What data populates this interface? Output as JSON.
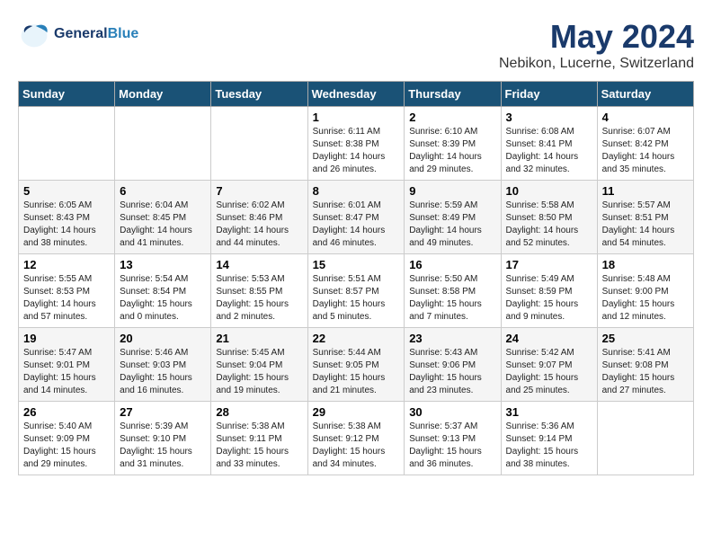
{
  "header": {
    "logo_general": "General",
    "logo_blue": "Blue",
    "month_year": "May 2024",
    "location": "Nebikon, Lucerne, Switzerland"
  },
  "days_of_week": [
    "Sunday",
    "Monday",
    "Tuesday",
    "Wednesday",
    "Thursday",
    "Friday",
    "Saturday"
  ],
  "weeks": [
    [
      {
        "day": "",
        "info": ""
      },
      {
        "day": "",
        "info": ""
      },
      {
        "day": "",
        "info": ""
      },
      {
        "day": "1",
        "info": "Sunrise: 6:11 AM\nSunset: 8:38 PM\nDaylight: 14 hours\nand 26 minutes."
      },
      {
        "day": "2",
        "info": "Sunrise: 6:10 AM\nSunset: 8:39 PM\nDaylight: 14 hours\nand 29 minutes."
      },
      {
        "day": "3",
        "info": "Sunrise: 6:08 AM\nSunset: 8:41 PM\nDaylight: 14 hours\nand 32 minutes."
      },
      {
        "day": "4",
        "info": "Sunrise: 6:07 AM\nSunset: 8:42 PM\nDaylight: 14 hours\nand 35 minutes."
      }
    ],
    [
      {
        "day": "5",
        "info": "Sunrise: 6:05 AM\nSunset: 8:43 PM\nDaylight: 14 hours\nand 38 minutes."
      },
      {
        "day": "6",
        "info": "Sunrise: 6:04 AM\nSunset: 8:45 PM\nDaylight: 14 hours\nand 41 minutes."
      },
      {
        "day": "7",
        "info": "Sunrise: 6:02 AM\nSunset: 8:46 PM\nDaylight: 14 hours\nand 44 minutes."
      },
      {
        "day": "8",
        "info": "Sunrise: 6:01 AM\nSunset: 8:47 PM\nDaylight: 14 hours\nand 46 minutes."
      },
      {
        "day": "9",
        "info": "Sunrise: 5:59 AM\nSunset: 8:49 PM\nDaylight: 14 hours\nand 49 minutes."
      },
      {
        "day": "10",
        "info": "Sunrise: 5:58 AM\nSunset: 8:50 PM\nDaylight: 14 hours\nand 52 minutes."
      },
      {
        "day": "11",
        "info": "Sunrise: 5:57 AM\nSunset: 8:51 PM\nDaylight: 14 hours\nand 54 minutes."
      }
    ],
    [
      {
        "day": "12",
        "info": "Sunrise: 5:55 AM\nSunset: 8:53 PM\nDaylight: 14 hours\nand 57 minutes."
      },
      {
        "day": "13",
        "info": "Sunrise: 5:54 AM\nSunset: 8:54 PM\nDaylight: 15 hours\nand 0 minutes."
      },
      {
        "day": "14",
        "info": "Sunrise: 5:53 AM\nSunset: 8:55 PM\nDaylight: 15 hours\nand 2 minutes."
      },
      {
        "day": "15",
        "info": "Sunrise: 5:51 AM\nSunset: 8:57 PM\nDaylight: 15 hours\nand 5 minutes."
      },
      {
        "day": "16",
        "info": "Sunrise: 5:50 AM\nSunset: 8:58 PM\nDaylight: 15 hours\nand 7 minutes."
      },
      {
        "day": "17",
        "info": "Sunrise: 5:49 AM\nSunset: 8:59 PM\nDaylight: 15 hours\nand 9 minutes."
      },
      {
        "day": "18",
        "info": "Sunrise: 5:48 AM\nSunset: 9:00 PM\nDaylight: 15 hours\nand 12 minutes."
      }
    ],
    [
      {
        "day": "19",
        "info": "Sunrise: 5:47 AM\nSunset: 9:01 PM\nDaylight: 15 hours\nand 14 minutes."
      },
      {
        "day": "20",
        "info": "Sunrise: 5:46 AM\nSunset: 9:03 PM\nDaylight: 15 hours\nand 16 minutes."
      },
      {
        "day": "21",
        "info": "Sunrise: 5:45 AM\nSunset: 9:04 PM\nDaylight: 15 hours\nand 19 minutes."
      },
      {
        "day": "22",
        "info": "Sunrise: 5:44 AM\nSunset: 9:05 PM\nDaylight: 15 hours\nand 21 minutes."
      },
      {
        "day": "23",
        "info": "Sunrise: 5:43 AM\nSunset: 9:06 PM\nDaylight: 15 hours\nand 23 minutes."
      },
      {
        "day": "24",
        "info": "Sunrise: 5:42 AM\nSunset: 9:07 PM\nDaylight: 15 hours\nand 25 minutes."
      },
      {
        "day": "25",
        "info": "Sunrise: 5:41 AM\nSunset: 9:08 PM\nDaylight: 15 hours\nand 27 minutes."
      }
    ],
    [
      {
        "day": "26",
        "info": "Sunrise: 5:40 AM\nSunset: 9:09 PM\nDaylight: 15 hours\nand 29 minutes."
      },
      {
        "day": "27",
        "info": "Sunrise: 5:39 AM\nSunset: 9:10 PM\nDaylight: 15 hours\nand 31 minutes."
      },
      {
        "day": "28",
        "info": "Sunrise: 5:38 AM\nSunset: 9:11 PM\nDaylight: 15 hours\nand 33 minutes."
      },
      {
        "day": "29",
        "info": "Sunrise: 5:38 AM\nSunset: 9:12 PM\nDaylight: 15 hours\nand 34 minutes."
      },
      {
        "day": "30",
        "info": "Sunrise: 5:37 AM\nSunset: 9:13 PM\nDaylight: 15 hours\nand 36 minutes."
      },
      {
        "day": "31",
        "info": "Sunrise: 5:36 AM\nSunset: 9:14 PM\nDaylight: 15 hours\nand 38 minutes."
      },
      {
        "day": "",
        "info": ""
      }
    ]
  ]
}
